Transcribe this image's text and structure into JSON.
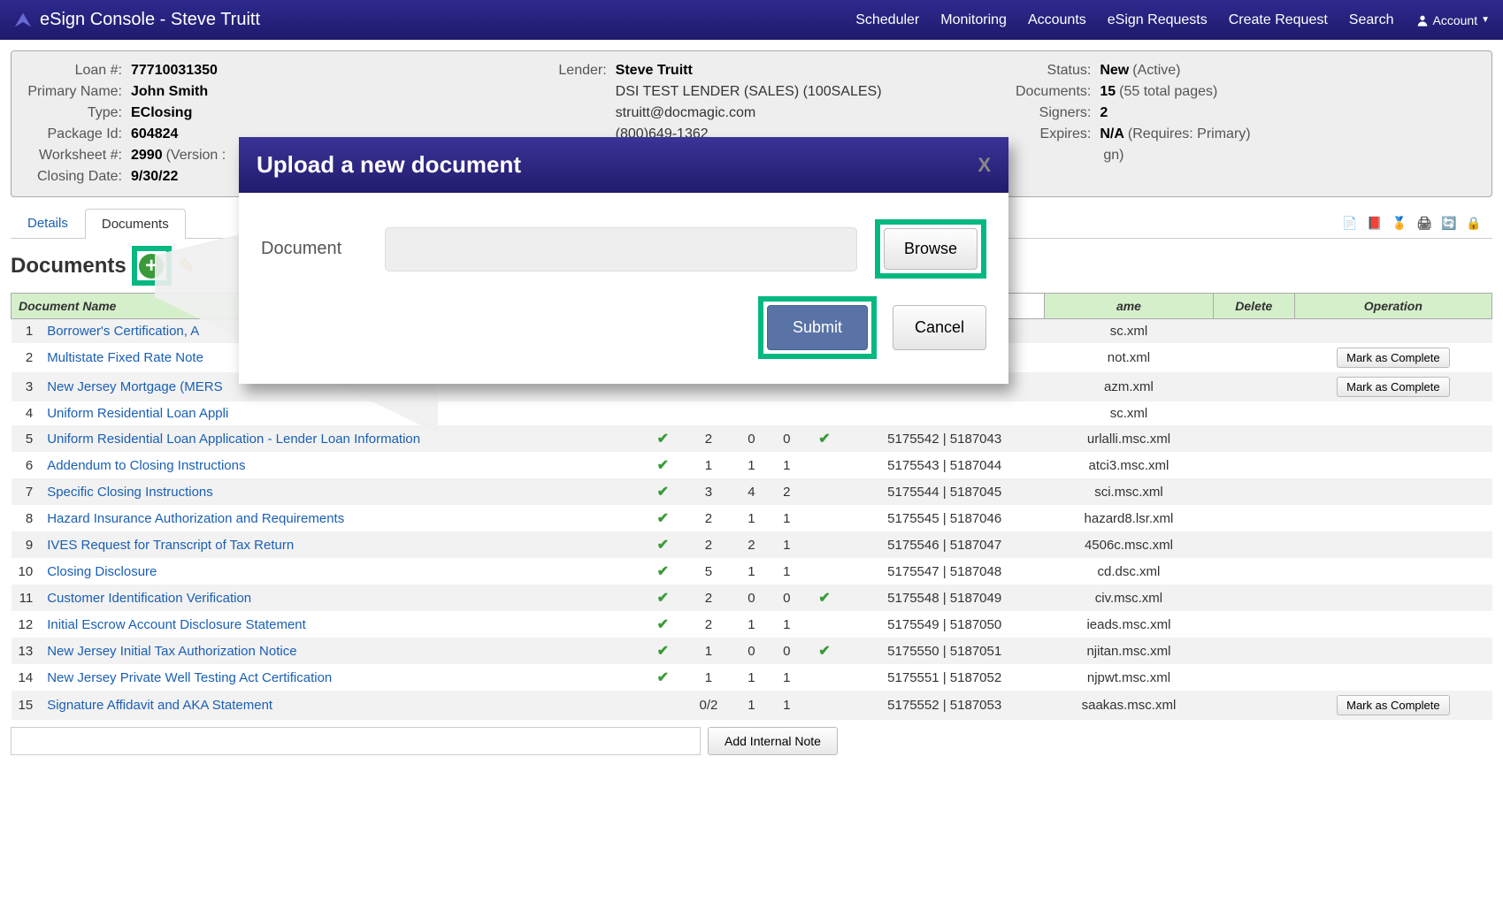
{
  "navbar": {
    "title": "eSign Console - Steve Truitt",
    "links": [
      "Scheduler",
      "Monitoring",
      "Accounts",
      "eSign Requests",
      "Create Request",
      "Search"
    ],
    "account": "Account"
  },
  "info": {
    "left": [
      {
        "label": "Loan #:",
        "value": "77710031350"
      },
      {
        "label": "Primary Name:",
        "value": "John Smith"
      },
      {
        "label": "Type:",
        "value": "EClosing"
      },
      {
        "label": "Package Id:",
        "value": "604824"
      },
      {
        "label": "Worksheet #:",
        "value": "2990",
        "sub": "(Version :"
      },
      {
        "label": "Closing Date:",
        "value": "9/30/22"
      }
    ],
    "middle_label": "Lender:",
    "middle": [
      "Steve Truitt",
      "DSI TEST LENDER (SALES) (100SALES)",
      "struitt@docmagic.com",
      "(800)649-1362"
    ],
    "right": [
      {
        "label": "Status:",
        "value": "New",
        "sub": "(Active)"
      },
      {
        "label": "Documents:",
        "value": "15",
        "sub": "(55 total pages)"
      },
      {
        "label": "Signers:",
        "value": "2"
      },
      {
        "label": "Expires:",
        "value": "N/A",
        "sub": "(Requires: Primary)"
      },
      {
        "label": "",
        "value": "",
        "sub": "gn)"
      }
    ]
  },
  "tabs": {
    "details": "Details",
    "documents": "Documents"
  },
  "section_title": "Documents",
  "table": {
    "headers": {
      "name": "Document Name",
      "filename_hdr": "ame",
      "delete": "Delete",
      "operation": "Operation"
    },
    "mark_label": "Mark as Complete",
    "rows": [
      {
        "idx": "1",
        "name": "Borrower's Certification, A",
        "signed": "",
        "p1": "",
        "p2": "",
        "p3": "",
        "viewed": "",
        "ids": "",
        "file": "sc.xml",
        "op": ""
      },
      {
        "idx": "2",
        "name": "Multistate Fixed Rate Note",
        "signed": "",
        "p1": "",
        "p2": "",
        "p3": "",
        "viewed": "",
        "ids": "",
        "file": "not.xml",
        "op": "mark"
      },
      {
        "idx": "3",
        "name": "New Jersey Mortgage (MERS",
        "signed": "",
        "p1": "",
        "p2": "",
        "p3": "",
        "viewed": "",
        "ids": "",
        "file": "azm.xml",
        "op": "mark"
      },
      {
        "idx": "4",
        "name": "Uniform Residential Loan Appli",
        "signed": "",
        "p1": "",
        "p2": "",
        "p3": "",
        "viewed": "",
        "ids": "",
        "file": "sc.xml",
        "op": ""
      },
      {
        "idx": "5",
        "name": "Uniform Residential Loan Application - Lender Loan Information",
        "signed": "y",
        "p1": "2",
        "p2": "0",
        "p3": "0",
        "viewed": "y",
        "ids": "5175542 | 5187043",
        "file": "urlalli.msc.xml",
        "op": ""
      },
      {
        "idx": "6",
        "name": "Addendum to Closing Instructions",
        "signed": "y",
        "p1": "1",
        "p2": "1",
        "p3": "1",
        "viewed": "",
        "ids": "5175543 | 5187044",
        "file": "atci3.msc.xml",
        "op": ""
      },
      {
        "idx": "7",
        "name": "Specific Closing Instructions",
        "signed": "y",
        "p1": "3",
        "p2": "4",
        "p3": "2",
        "viewed": "",
        "ids": "5175544 | 5187045",
        "file": "sci.msc.xml",
        "op": ""
      },
      {
        "idx": "8",
        "name": "Hazard Insurance Authorization and Requirements",
        "signed": "y",
        "p1": "2",
        "p2": "1",
        "p3": "1",
        "viewed": "",
        "ids": "5175545 | 5187046",
        "file": "hazard8.lsr.xml",
        "op": ""
      },
      {
        "idx": "9",
        "name": "IVES Request for Transcript of Tax Return",
        "signed": "y",
        "p1": "2",
        "p2": "2",
        "p3": "1",
        "viewed": "",
        "ids": "5175546 | 5187047",
        "file": "4506c.msc.xml",
        "op": ""
      },
      {
        "idx": "10",
        "name": "Closing Disclosure",
        "signed": "y",
        "p1": "5",
        "p2": "1",
        "p3": "1",
        "viewed": "",
        "ids": "5175547 | 5187048",
        "file": "cd.dsc.xml",
        "op": ""
      },
      {
        "idx": "11",
        "name": "Customer Identification Verification",
        "signed": "y",
        "p1": "2",
        "p2": "0",
        "p3": "0",
        "viewed": "y",
        "ids": "5175548 | 5187049",
        "file": "civ.msc.xml",
        "op": ""
      },
      {
        "idx": "12",
        "name": "Initial Escrow Account Disclosure Statement",
        "signed": "y",
        "p1": "2",
        "p2": "1",
        "p3": "1",
        "viewed": "",
        "ids": "5175549 | 5187050",
        "file": "ieads.msc.xml",
        "op": ""
      },
      {
        "idx": "13",
        "name": "New Jersey Initial Tax Authorization Notice",
        "signed": "y",
        "p1": "1",
        "p2": "0",
        "p3": "0",
        "viewed": "y",
        "ids": "5175550 | 5187051",
        "file": "njitan.msc.xml",
        "op": ""
      },
      {
        "idx": "14",
        "name": "New Jersey Private Well Testing Act Certification",
        "signed": "y",
        "p1": "1",
        "p2": "1",
        "p3": "1",
        "viewed": "",
        "ids": "5175551 | 5187052",
        "file": "njpwt.msc.xml",
        "op": ""
      },
      {
        "idx": "15",
        "name": "Signature Affidavit and AKA Statement",
        "signed": "",
        "p1": "0/2",
        "p2": "1",
        "p3": "1",
        "viewed": "",
        "ids": "5175552 | 5187053",
        "file": "saakas.msc.xml",
        "op": "mark"
      }
    ]
  },
  "note_button": "Add Internal Note",
  "modal": {
    "title": "Upload a new document",
    "field_label": "Document",
    "browse": "Browse",
    "submit": "Submit",
    "cancel": "Cancel",
    "close": "X"
  }
}
